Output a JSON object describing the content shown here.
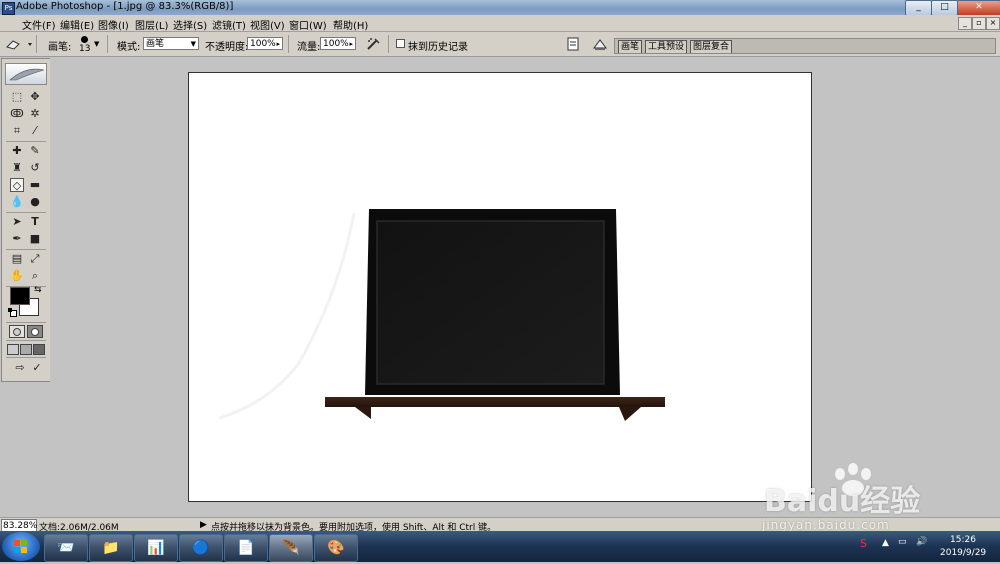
{
  "window": {
    "title": "Adobe Photoshop - [1.jpg @ 83.3%(RGB/8)]",
    "app_icon": "Ps",
    "minimize": "_",
    "maximize": "□",
    "close": "✕"
  },
  "menu": {
    "items": [
      "文件(F)",
      "编辑(E)",
      "图像(I)",
      "图层(L)",
      "选择(S)",
      "滤镜(T)",
      "视图(V)",
      "窗口(W)",
      "帮助(H)"
    ],
    "mdi_minimize": "_",
    "mdi_restore": "▫",
    "mdi_close": "×"
  },
  "options": {
    "brush_label": "画笔:",
    "brush_size": "13",
    "mode_label": "模式:",
    "mode_value": "画笔",
    "opacity_label": "不透明度:",
    "opacity_value": "100%",
    "flow_label": "流量:",
    "flow_value": "100%",
    "erase_history_label": "抹到历史记录",
    "erase_history_checked": false,
    "panel_tabs": [
      "画笔",
      "工具预设",
      "图层复合"
    ]
  },
  "toolbox": {
    "icons": [
      "marquee-icon",
      "move-icon",
      "lasso-icon",
      "magic-wand-icon",
      "crop-icon",
      "slice-icon",
      "healing-icon",
      "brush-icon",
      "stamp-icon",
      "history-brush-icon",
      "eraser-icon",
      "gradient-icon",
      "blur-icon",
      "dodge-icon",
      "path-select-icon",
      "type-icon",
      "pen-icon",
      "shape-icon",
      "notes-icon",
      "eyedropper-icon",
      "hand-icon",
      "zoom-icon"
    ],
    "foreground_color": "#000000",
    "background_color": "#ffffff",
    "active_tool": "eraser-icon"
  },
  "status": {
    "zoom": "83.28%",
    "doc_size": "文档:2.06M/2.06M",
    "hint": "点按并拖移以抹为背景色。要用附加选项，使用 Shift、Alt 和 Ctrl 键。"
  },
  "taskbar": {
    "time": "15:26",
    "date": "2019/9/29"
  },
  "watermark": {
    "brand": "Baidu经验",
    "url": "jingyan.baidu.com"
  }
}
